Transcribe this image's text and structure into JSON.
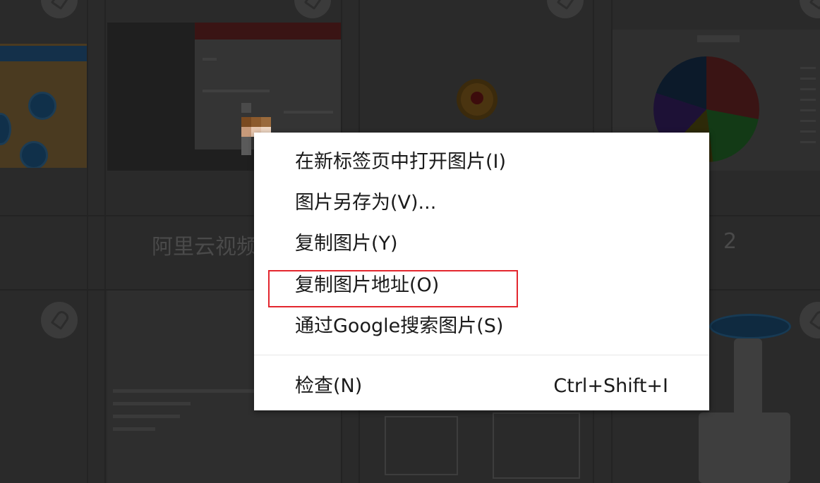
{
  "gallery": {
    "caption_left": "阿里云视频",
    "caption_right": "2"
  },
  "context_menu": {
    "items": [
      {
        "label": "在新标签页中打开图片(I)"
      },
      {
        "label": "图片另存为(V)..."
      },
      {
        "label": "复制图片(Y)"
      },
      {
        "label": "复制图片地址(O)",
        "highlighted": true
      },
      {
        "label": "通过Google搜索图片(S)"
      },
      {
        "label": "检查(N)",
        "shortcut": "Ctrl+Shift+I"
      }
    ]
  },
  "colors": {
    "menu_background": "#ffffff",
    "highlight_border": "#e3262e",
    "overlay": "#2a2a2a"
  }
}
